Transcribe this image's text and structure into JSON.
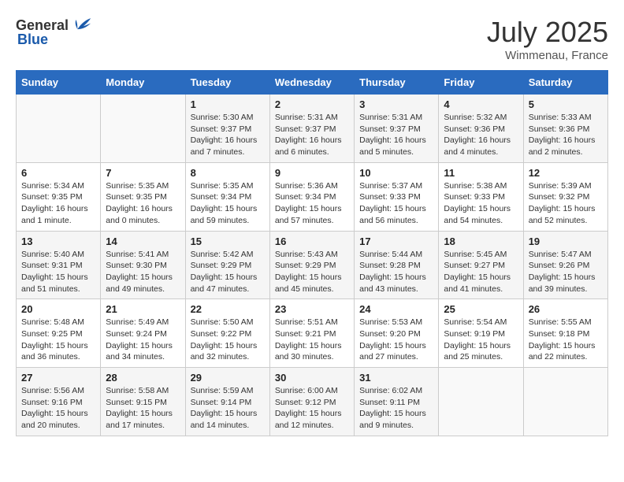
{
  "header": {
    "logo_general": "General",
    "logo_blue": "Blue",
    "month_year": "July 2025",
    "location": "Wimmenau, France"
  },
  "calendar": {
    "days_of_week": [
      "Sunday",
      "Monday",
      "Tuesday",
      "Wednesday",
      "Thursday",
      "Friday",
      "Saturday"
    ],
    "weeks": [
      [
        {
          "day": "",
          "info": ""
        },
        {
          "day": "",
          "info": ""
        },
        {
          "day": "1",
          "info": "Sunrise: 5:30 AM\nSunset: 9:37 PM\nDaylight: 16 hours and 7 minutes."
        },
        {
          "day": "2",
          "info": "Sunrise: 5:31 AM\nSunset: 9:37 PM\nDaylight: 16 hours and 6 minutes."
        },
        {
          "day": "3",
          "info": "Sunrise: 5:31 AM\nSunset: 9:37 PM\nDaylight: 16 hours and 5 minutes."
        },
        {
          "day": "4",
          "info": "Sunrise: 5:32 AM\nSunset: 9:36 PM\nDaylight: 16 hours and 4 minutes."
        },
        {
          "day": "5",
          "info": "Sunrise: 5:33 AM\nSunset: 9:36 PM\nDaylight: 16 hours and 2 minutes."
        }
      ],
      [
        {
          "day": "6",
          "info": "Sunrise: 5:34 AM\nSunset: 9:35 PM\nDaylight: 16 hours and 1 minute."
        },
        {
          "day": "7",
          "info": "Sunrise: 5:35 AM\nSunset: 9:35 PM\nDaylight: 16 hours and 0 minutes."
        },
        {
          "day": "8",
          "info": "Sunrise: 5:35 AM\nSunset: 9:34 PM\nDaylight: 15 hours and 59 minutes."
        },
        {
          "day": "9",
          "info": "Sunrise: 5:36 AM\nSunset: 9:34 PM\nDaylight: 15 hours and 57 minutes."
        },
        {
          "day": "10",
          "info": "Sunrise: 5:37 AM\nSunset: 9:33 PM\nDaylight: 15 hours and 56 minutes."
        },
        {
          "day": "11",
          "info": "Sunrise: 5:38 AM\nSunset: 9:33 PM\nDaylight: 15 hours and 54 minutes."
        },
        {
          "day": "12",
          "info": "Sunrise: 5:39 AM\nSunset: 9:32 PM\nDaylight: 15 hours and 52 minutes."
        }
      ],
      [
        {
          "day": "13",
          "info": "Sunrise: 5:40 AM\nSunset: 9:31 PM\nDaylight: 15 hours and 51 minutes."
        },
        {
          "day": "14",
          "info": "Sunrise: 5:41 AM\nSunset: 9:30 PM\nDaylight: 15 hours and 49 minutes."
        },
        {
          "day": "15",
          "info": "Sunrise: 5:42 AM\nSunset: 9:29 PM\nDaylight: 15 hours and 47 minutes."
        },
        {
          "day": "16",
          "info": "Sunrise: 5:43 AM\nSunset: 9:29 PM\nDaylight: 15 hours and 45 minutes."
        },
        {
          "day": "17",
          "info": "Sunrise: 5:44 AM\nSunset: 9:28 PM\nDaylight: 15 hours and 43 minutes."
        },
        {
          "day": "18",
          "info": "Sunrise: 5:45 AM\nSunset: 9:27 PM\nDaylight: 15 hours and 41 minutes."
        },
        {
          "day": "19",
          "info": "Sunrise: 5:47 AM\nSunset: 9:26 PM\nDaylight: 15 hours and 39 minutes."
        }
      ],
      [
        {
          "day": "20",
          "info": "Sunrise: 5:48 AM\nSunset: 9:25 PM\nDaylight: 15 hours and 36 minutes."
        },
        {
          "day": "21",
          "info": "Sunrise: 5:49 AM\nSunset: 9:24 PM\nDaylight: 15 hours and 34 minutes."
        },
        {
          "day": "22",
          "info": "Sunrise: 5:50 AM\nSunset: 9:22 PM\nDaylight: 15 hours and 32 minutes."
        },
        {
          "day": "23",
          "info": "Sunrise: 5:51 AM\nSunset: 9:21 PM\nDaylight: 15 hours and 30 minutes."
        },
        {
          "day": "24",
          "info": "Sunrise: 5:53 AM\nSunset: 9:20 PM\nDaylight: 15 hours and 27 minutes."
        },
        {
          "day": "25",
          "info": "Sunrise: 5:54 AM\nSunset: 9:19 PM\nDaylight: 15 hours and 25 minutes."
        },
        {
          "day": "26",
          "info": "Sunrise: 5:55 AM\nSunset: 9:18 PM\nDaylight: 15 hours and 22 minutes."
        }
      ],
      [
        {
          "day": "27",
          "info": "Sunrise: 5:56 AM\nSunset: 9:16 PM\nDaylight: 15 hours and 20 minutes."
        },
        {
          "day": "28",
          "info": "Sunrise: 5:58 AM\nSunset: 9:15 PM\nDaylight: 15 hours and 17 minutes."
        },
        {
          "day": "29",
          "info": "Sunrise: 5:59 AM\nSunset: 9:14 PM\nDaylight: 15 hours and 14 minutes."
        },
        {
          "day": "30",
          "info": "Sunrise: 6:00 AM\nSunset: 9:12 PM\nDaylight: 15 hours and 12 minutes."
        },
        {
          "day": "31",
          "info": "Sunrise: 6:02 AM\nSunset: 9:11 PM\nDaylight: 15 hours and 9 minutes."
        },
        {
          "day": "",
          "info": ""
        },
        {
          "day": "",
          "info": ""
        }
      ]
    ]
  }
}
